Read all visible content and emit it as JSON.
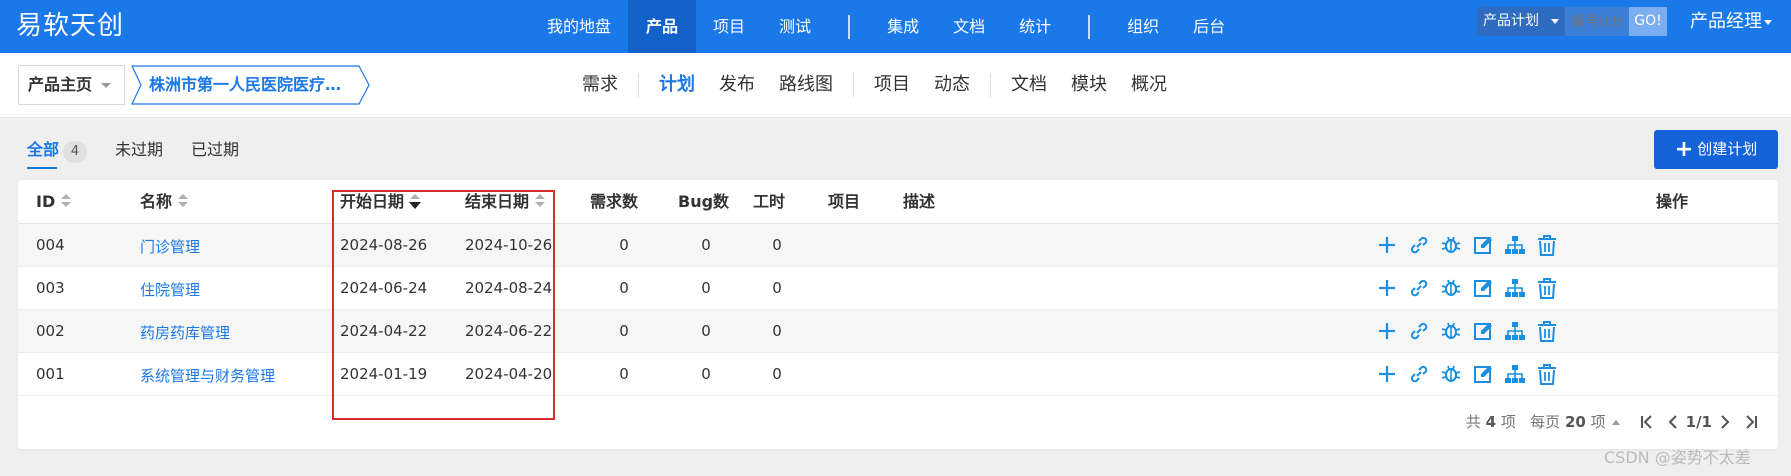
{
  "app": {
    "brand": "易软天创"
  },
  "mainnav": {
    "items": [
      {
        "label": "我的地盘"
      },
      {
        "label": "产品"
      },
      {
        "label": "项目"
      },
      {
        "label": "测试"
      },
      {
        "label": "集成"
      },
      {
        "label": "文档"
      },
      {
        "label": "统计"
      },
      {
        "label": "组织"
      },
      {
        "label": "后台"
      }
    ],
    "active": "产品"
  },
  "search": {
    "type": "产品计划",
    "placeholder": "编号(ctr",
    "go": "GO!"
  },
  "user": {
    "role": "产品经理"
  },
  "breadcrumb": {
    "home": "产品主页",
    "product": "株洲市第一人民医院医疗…"
  },
  "subnav": {
    "items": [
      {
        "label": "需求"
      },
      {
        "label": "计划"
      },
      {
        "label": "发布"
      },
      {
        "label": "路线图"
      },
      {
        "label": "项目"
      },
      {
        "label": "动态"
      },
      {
        "label": "文档"
      },
      {
        "label": "模块"
      },
      {
        "label": "概况"
      }
    ],
    "active": "计划"
  },
  "filters": {
    "all": "全部",
    "all_count": "4",
    "unexpired": "未过期",
    "expired": "已过期"
  },
  "create_button": "创建计划",
  "table": {
    "headers": {
      "id": "ID",
      "name": "名称",
      "begin": "开始日期",
      "end": "结束日期",
      "stories": "需求数",
      "bugs": "Bug数",
      "hours": "工时",
      "project": "项目",
      "desc": "描述",
      "actions": "操作"
    },
    "rows": [
      {
        "id": "004",
        "name": "门诊管理",
        "begin": "2024-08-26",
        "end": "2024-10-26",
        "stories": "0",
        "bugs": "0",
        "hours": "0"
      },
      {
        "id": "003",
        "name": "住院管理",
        "begin": "2024-06-24",
        "end": "2024-08-24",
        "stories": "0",
        "bugs": "0",
        "hours": "0"
      },
      {
        "id": "002",
        "name": "药房药库管理",
        "begin": "2024-04-22",
        "end": "2024-06-22",
        "stories": "0",
        "bugs": "0",
        "hours": "0"
      },
      {
        "id": "001",
        "name": "系统管理与财务管理",
        "begin": "2024-01-19",
        "end": "2024-04-20",
        "stories": "0",
        "bugs": "0",
        "hours": "0"
      }
    ]
  },
  "pager": {
    "total_prefix": "共",
    "total": "4",
    "total_suffix": "项",
    "per_page_prefix": "每页",
    "per_page": "20",
    "per_page_suffix": "项",
    "page": "1/1"
  },
  "colors": {
    "brand": "#1a78e8",
    "active_nav": "#1261c9",
    "highlight_box": "#d32f2f"
  },
  "watermark": "CSDN @姿势不太差"
}
